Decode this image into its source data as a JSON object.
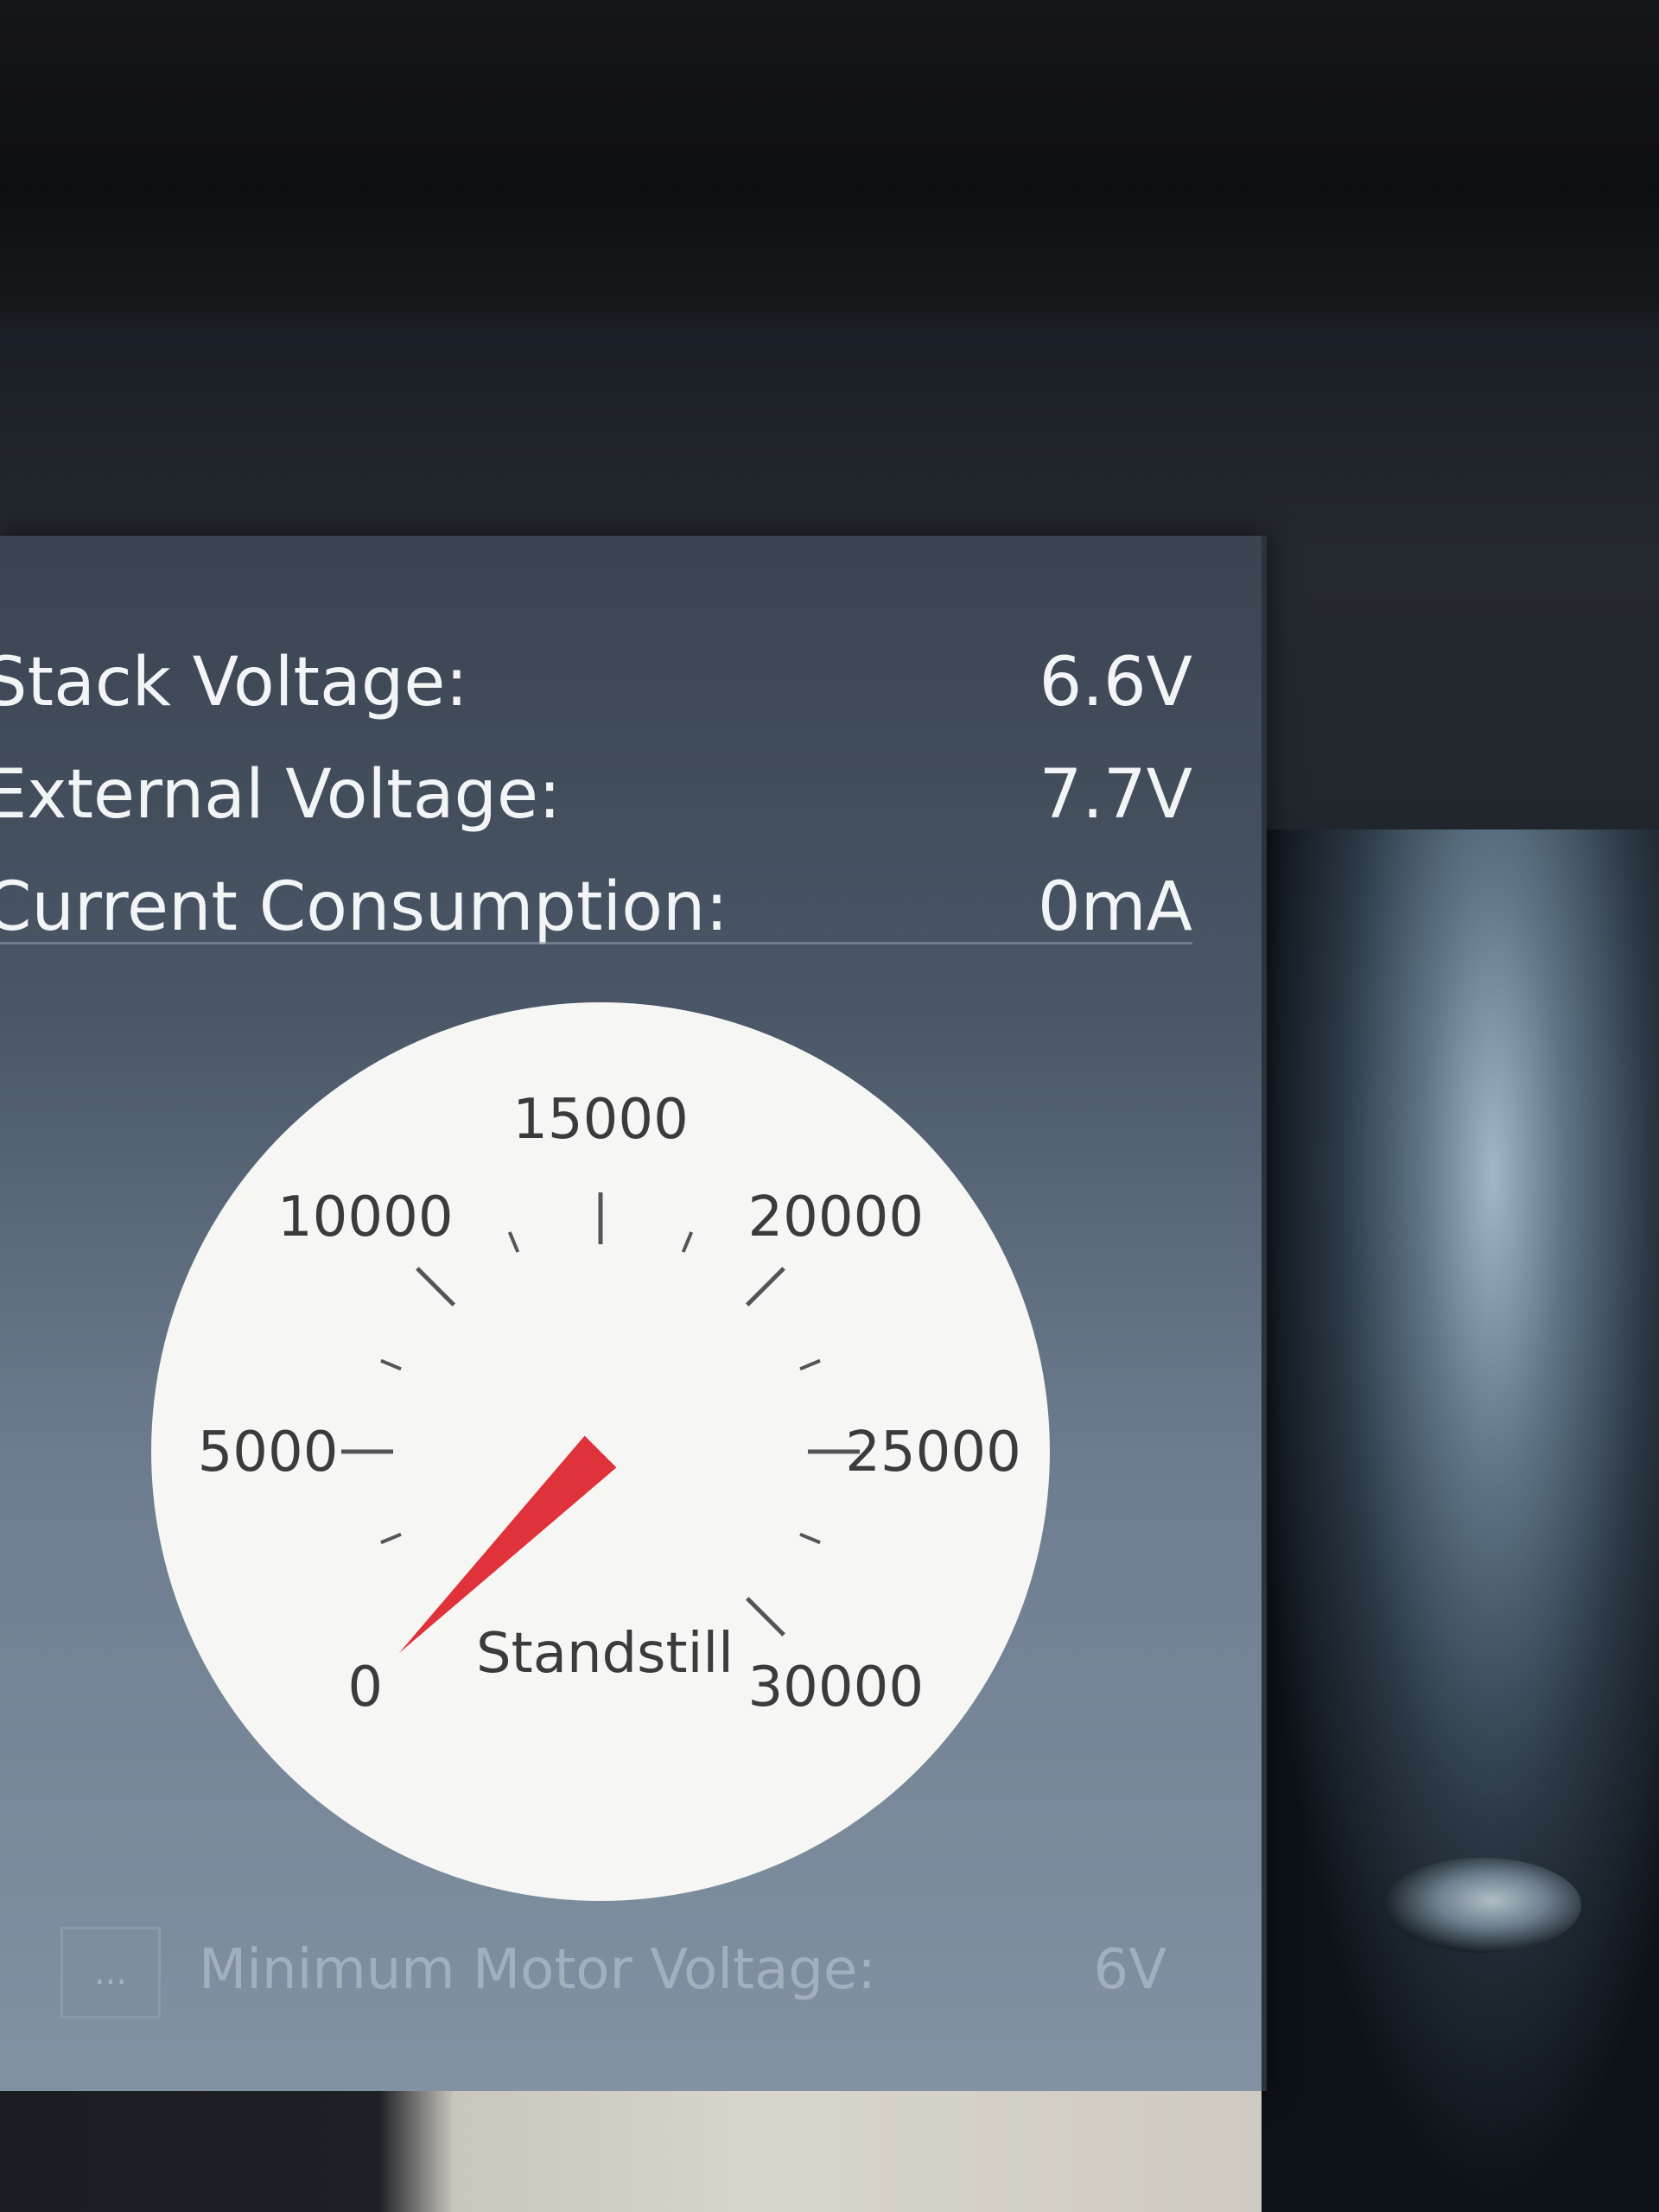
{
  "stats": [
    {
      "label": "Stack Voltage:",
      "value": "6.6V"
    },
    {
      "label": "External Voltage:",
      "value": "7.7V"
    },
    {
      "label": "Current Consumption:",
      "value": "0mA"
    }
  ],
  "gauge": {
    "min": 0,
    "max": 30000,
    "reading": 0,
    "status_label": "Standstill",
    "tick_labels": [
      "0",
      "5000",
      "10000",
      "15000",
      "20000",
      "25000",
      "30000"
    ],
    "needle_color": "#e0323a",
    "face_color": "#f6f6f4"
  },
  "motor": {
    "button_label": "...",
    "label": "Minimum Motor Voltage:",
    "value": "6V"
  },
  "colors": {
    "panel": "#4a5666",
    "text": "#f2f4f6",
    "disabled_text": "#a3afbc"
  }
}
